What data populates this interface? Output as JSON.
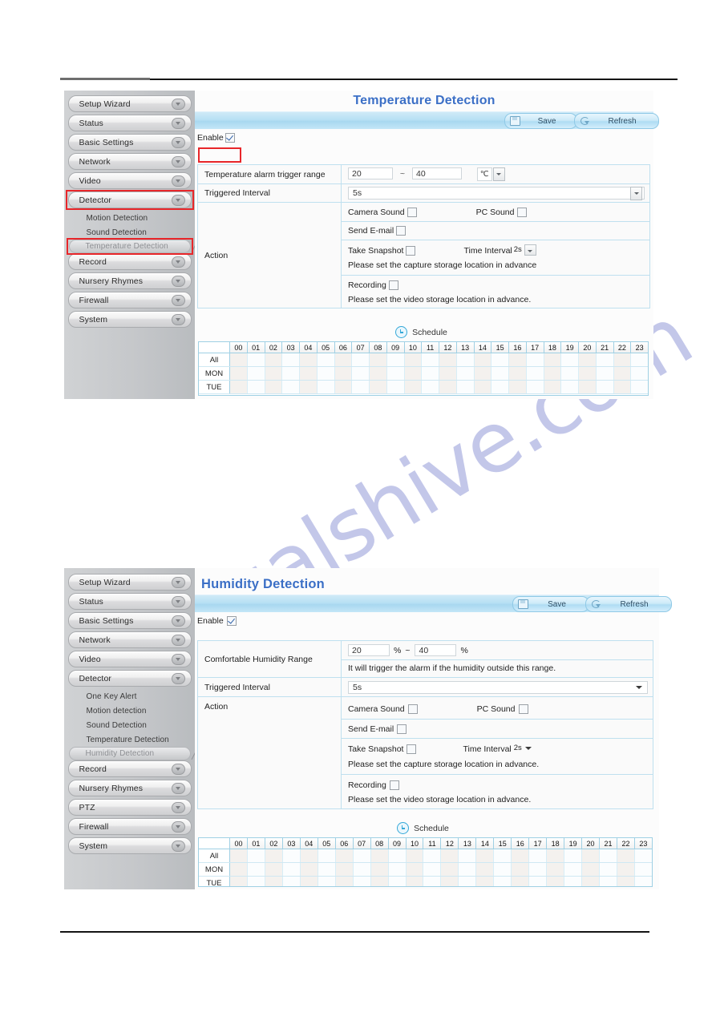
{
  "watermark": {
    "text": "manualshive.com"
  },
  "panels": [
    {
      "id": "temperature",
      "title": "Temperature Detection",
      "toolbar": {
        "save_label": "Save",
        "refresh_label": "Refresh"
      },
      "enable": {
        "label": "Enable",
        "checked": true,
        "highlighted": true
      },
      "rows": [
        {
          "label": "Temperature alarm trigger range",
          "min": "20",
          "sep": "~",
          "max": "40",
          "unit": "℃"
        },
        {
          "label": "Triggered Interval",
          "value": "5s"
        }
      ],
      "action": {
        "label": "Action",
        "camera_sound": "Camera Sound",
        "pc_sound": "PC Sound",
        "send_email": "Send E-mail",
        "take_snapshot": "Take Snapshot",
        "time_interval_label": "Time Interval",
        "time_interval_value": "2s",
        "snapshot_note": "Please set the capture storage location in advance",
        "recording": "Recording",
        "recording_note": "Please set the video storage location in advance."
      },
      "schedule": {
        "title": "Schedule",
        "all_label": "All",
        "hours": [
          "00",
          "01",
          "02",
          "03",
          "04",
          "05",
          "06",
          "07",
          "08",
          "09",
          "10",
          "11",
          "12",
          "13",
          "14",
          "15",
          "16",
          "17",
          "18",
          "19",
          "20",
          "21",
          "22",
          "23"
        ],
        "days": [
          "MON",
          "TUE"
        ]
      },
      "sidebar": {
        "items": [
          {
            "label": "Setup Wizard",
            "type": "group"
          },
          {
            "label": "Status",
            "type": "group"
          },
          {
            "label": "Basic Settings",
            "type": "group"
          },
          {
            "label": "Network",
            "type": "group"
          },
          {
            "label": "Video",
            "type": "group"
          },
          {
            "label": "Detector",
            "type": "group",
            "highlighted": true
          },
          {
            "label": "Motion Detection",
            "type": "sub"
          },
          {
            "label": "Sound Detection",
            "type": "sub"
          },
          {
            "label": "Temperature Detection",
            "type": "sub",
            "selected": true,
            "highlighted": true
          },
          {
            "label": "Record",
            "type": "group"
          },
          {
            "label": "Nursery Rhymes",
            "type": "group"
          },
          {
            "label": "Firewall",
            "type": "group"
          },
          {
            "label": "System",
            "type": "group"
          }
        ]
      }
    },
    {
      "id": "humidity",
      "title": "Humidity Detection",
      "toolbar": {
        "save_label": "Save",
        "refresh_label": "Refresh"
      },
      "enable": {
        "label": "Enable",
        "checked": true,
        "highlighted": false
      },
      "rows": [
        {
          "label": "Comfortable Humidity Range",
          "min": "20",
          "unit_min": "%",
          "sep": "~",
          "max": "40",
          "unit_max": "%",
          "note": "It will trigger the alarm if the humidity outside this range."
        },
        {
          "label": "Triggered Interval",
          "value": "5s"
        }
      ],
      "action": {
        "label": "Action",
        "camera_sound": "Camera Sound",
        "pc_sound": "PC Sound",
        "send_email": "Send E-mail",
        "take_snapshot": "Take Snapshot",
        "time_interval_label": "Time Interval",
        "time_interval_value": "2s",
        "snapshot_note": "Please set the capture storage location in advance.",
        "recording": "Recording",
        "recording_note": "Please set the video storage location in advance."
      },
      "schedule": {
        "title": "Schedule",
        "all_label": "All",
        "hours": [
          "00",
          "01",
          "02",
          "03",
          "04",
          "05",
          "06",
          "07",
          "08",
          "09",
          "10",
          "11",
          "12",
          "13",
          "14",
          "15",
          "16",
          "17",
          "18",
          "19",
          "20",
          "21",
          "22",
          "23"
        ],
        "days": [
          "MON",
          "TUE"
        ]
      },
      "sidebar": {
        "items": [
          {
            "label": "Setup Wizard",
            "type": "group"
          },
          {
            "label": "Status",
            "type": "group"
          },
          {
            "label": "Basic Settings",
            "type": "group"
          },
          {
            "label": "Network",
            "type": "group"
          },
          {
            "label": "Video",
            "type": "group"
          },
          {
            "label": "Detector",
            "type": "group"
          },
          {
            "label": "One Key Alert",
            "type": "sub"
          },
          {
            "label": "Motion detection",
            "type": "sub"
          },
          {
            "label": "Sound Detection",
            "type": "sub"
          },
          {
            "label": "Temperature Detection",
            "type": "sub"
          },
          {
            "label": "Humidity Detection",
            "type": "sub",
            "selected": true
          },
          {
            "label": "Record",
            "type": "group"
          },
          {
            "label": "Nursery Rhymes",
            "type": "group"
          },
          {
            "label": "PTZ",
            "type": "group"
          },
          {
            "label": "Firewall",
            "type": "group"
          },
          {
            "label": "System",
            "type": "group"
          }
        ]
      }
    }
  ]
}
